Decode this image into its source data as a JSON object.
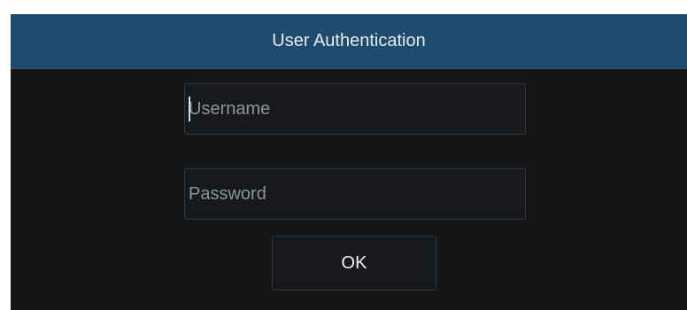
{
  "dialog": {
    "title": "User Authentication"
  },
  "form": {
    "username_placeholder": "Username",
    "password_placeholder": "Password",
    "ok_label": "OK"
  },
  "colors": {
    "titlebar": "#1e4b6e",
    "background": "#141517",
    "field_border": "#2c3846"
  }
}
